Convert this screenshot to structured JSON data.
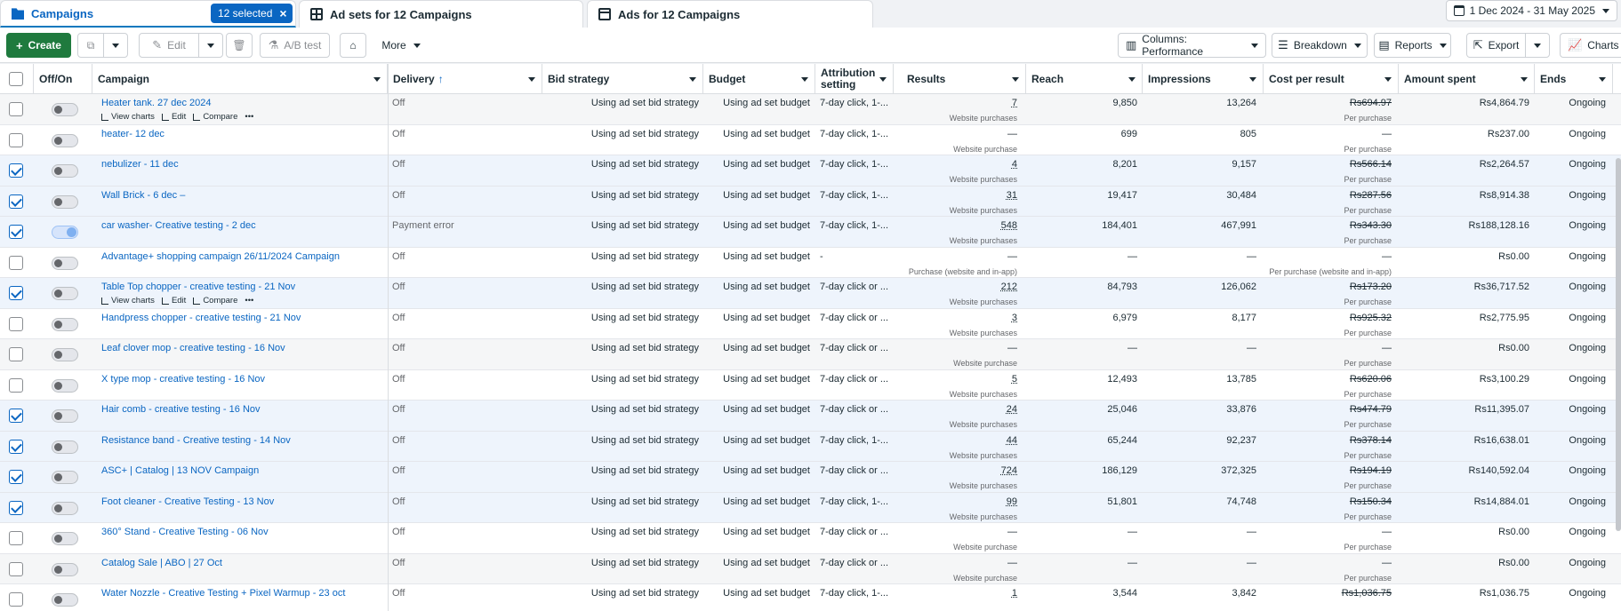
{
  "tabs": {
    "campaigns": "Campaigns",
    "selected": "12 selected",
    "adsets": "Ad sets for 12 Campaigns",
    "ads": "Ads for 12 Campaigns"
  },
  "date_range": "1 Dec 2024 - 31 May 2025",
  "toolbar": {
    "create": "Create",
    "edit": "Edit",
    "ab_test": "A/B test",
    "more": "More",
    "columns": "Columns: Performance",
    "breakdown": "Breakdown",
    "reports": "Reports",
    "export": "Export",
    "charts": "Charts"
  },
  "columns": {
    "onoff": "Off/On",
    "campaign": "Campaign",
    "delivery": "Delivery",
    "bid_strategy": "Bid strategy",
    "budget": "Budget",
    "attribution": "Attribution setting",
    "results": "Results",
    "reach": "Reach",
    "impressions": "Impressions",
    "cpr": "Cost per result",
    "amount": "Amount spent",
    "ends": "Ends"
  },
  "row_actions": {
    "view_charts": "View charts",
    "edit": "Edit",
    "compare": "Compare",
    "more": "•••"
  },
  "rows": [
    {
      "name": "Heater tank. 27 dec 2024",
      "delivery": "Off",
      "bid": "Using ad set bid strategy",
      "budget": "Using ad set budget",
      "attr": "7-day click, 1-...",
      "results": "7",
      "results_sub": "Website purchases",
      "reach": "9,850",
      "imp": "13,264",
      "cpr": "Rs694.97",
      "cpr_sub": "Per purchase",
      "amount": "Rs4,864.79",
      "ends": "Ongoing"
    },
    {
      "name": "heater- 12 dec",
      "delivery": "Off",
      "bid": "Using ad set bid strategy",
      "budget": "Using ad set budget",
      "attr": "7-day click, 1-...",
      "results": "—",
      "results_sub": "Website purchase",
      "reach": "699",
      "imp": "805",
      "cpr": "—",
      "cpr_sub": "Per purchase",
      "amount": "Rs237.00",
      "ends": "Ongoing"
    },
    {
      "name": "nebulizer - 11 dec",
      "delivery": "Off",
      "bid": "Using ad set bid strategy",
      "budget": "Using ad set budget",
      "attr": "7-day click, 1-...",
      "results": "4",
      "results_sub": "Website purchases",
      "reach": "8,201",
      "imp": "9,157",
      "cpr": "Rs566.14",
      "cpr_sub": "Per purchase",
      "amount": "Rs2,264.57",
      "ends": "Ongoing"
    },
    {
      "name": "Wall Brick - 6 dec –",
      "delivery": "Off",
      "bid": "Using ad set bid strategy",
      "budget": "Using ad set budget",
      "attr": "7-day click, 1-...",
      "results": "31",
      "results_sub": "Website purchases",
      "reach": "19,417",
      "imp": "30,484",
      "cpr": "Rs287.56",
      "cpr_sub": "Per purchase",
      "amount": "Rs8,914.38",
      "ends": "Ongoing"
    },
    {
      "name": "car washer- Creative testing - 2 dec",
      "delivery": "Payment error",
      "bid": "Using ad set bid strategy",
      "budget": "Using ad set budget",
      "attr": "7-day click, 1-...",
      "results": "548",
      "results_sub": "Website purchases",
      "reach": "184,401",
      "imp": "467,991",
      "cpr": "Rs343.30",
      "cpr_sub": "Per purchase",
      "amount": "Rs188,128.16",
      "ends": "Ongoing"
    },
    {
      "name": "Advantage+ shopping campaign 26/11/2024 Campaign",
      "delivery": "Off",
      "bid": "Using ad set bid strategy",
      "budget": "Using ad set budget",
      "attr": "-",
      "results": "—",
      "results_sub": "Purchase (website and in-app)",
      "reach": "—",
      "imp": "—",
      "cpr": "—",
      "cpr_sub": "Per purchase (website and in-app)",
      "amount": "Rs0.00",
      "ends": "Ongoing"
    },
    {
      "name": "Table Top chopper - creative testing - 21 Nov",
      "delivery": "Off",
      "bid": "Using ad set bid strategy",
      "budget": "Using ad set budget",
      "attr": "7-day click or ...",
      "results": "212",
      "results_sub": "Website purchases",
      "reach": "84,793",
      "imp": "126,062",
      "cpr": "Rs173.20",
      "cpr_sub": "Per purchase",
      "amount": "Rs36,717.52",
      "ends": "Ongoing"
    },
    {
      "name": "Handpress chopper - creative testing - 21 Nov",
      "delivery": "Off",
      "bid": "Using ad set bid strategy",
      "budget": "Using ad set budget",
      "attr": "7-day click or ...",
      "results": "3",
      "results_sub": "Website purchases",
      "reach": "6,979",
      "imp": "8,177",
      "cpr": "Rs925.32",
      "cpr_sub": "Per purchase",
      "amount": "Rs2,775.95",
      "ends": "Ongoing"
    },
    {
      "name": "Leaf clover mop - creative testing - 16 Nov",
      "delivery": "Off",
      "bid": "Using ad set bid strategy",
      "budget": "Using ad set budget",
      "attr": "7-day click or ...",
      "results": "—",
      "results_sub": "Website purchase",
      "reach": "—",
      "imp": "—",
      "cpr": "—",
      "cpr_sub": "Per purchase",
      "amount": "Rs0.00",
      "ends": "Ongoing"
    },
    {
      "name": "X type mop - creative testing - 16 Nov",
      "delivery": "Off",
      "bid": "Using ad set bid strategy",
      "budget": "Using ad set budget",
      "attr": "7-day click or ...",
      "results": "5",
      "results_sub": "Website purchases",
      "reach": "12,493",
      "imp": "13,785",
      "cpr": "Rs620.06",
      "cpr_sub": "Per purchase",
      "amount": "Rs3,100.29",
      "ends": "Ongoing"
    },
    {
      "name": "Hair comb - creative testing - 16 Nov",
      "delivery": "Off",
      "bid": "Using ad set bid strategy",
      "budget": "Using ad set budget",
      "attr": "7-day click or ...",
      "results": "24",
      "results_sub": "Website purchases",
      "reach": "25,046",
      "imp": "33,876",
      "cpr": "Rs474.79",
      "cpr_sub": "Per purchase",
      "amount": "Rs11,395.07",
      "ends": "Ongoing"
    },
    {
      "name": "Resistance band - Creative testing - 14 Nov",
      "delivery": "Off",
      "bid": "Using ad set bid strategy",
      "budget": "Using ad set budget",
      "attr": "7-day click, 1-...",
      "results": "44",
      "results_sub": "Website purchases",
      "reach": "65,244",
      "imp": "92,237",
      "cpr": "Rs378.14",
      "cpr_sub": "Per purchase",
      "amount": "Rs16,638.01",
      "ends": "Ongoing"
    },
    {
      "name": "ASC+ | Catalog | 13 NOV Campaign",
      "delivery": "Off",
      "bid": "Using ad set bid strategy",
      "budget": "Using ad set budget",
      "attr": "7-day click or ...",
      "results": "724",
      "results_sub": "Website purchases",
      "reach": "186,129",
      "imp": "372,325",
      "cpr": "Rs194.19",
      "cpr_sub": "Per purchase",
      "amount": "Rs140,592.04",
      "ends": "Ongoing"
    },
    {
      "name": "Foot cleaner - Creative Testing - 13 Nov",
      "delivery": "Off",
      "bid": "Using ad set bid strategy",
      "budget": "Using ad set budget",
      "attr": "7-day click, 1-...",
      "results": "99",
      "results_sub": "Website purchases",
      "reach": "51,801",
      "imp": "74,748",
      "cpr": "Rs150.34",
      "cpr_sub": "Per purchase",
      "amount": "Rs14,884.01",
      "ends": "Ongoing"
    },
    {
      "name": "360° Stand - Creative Testing - 06 Nov",
      "delivery": "Off",
      "bid": "Using ad set bid strategy",
      "budget": "Using ad set budget",
      "attr": "7-day click or ...",
      "results": "—",
      "results_sub": "Website purchase",
      "reach": "—",
      "imp": "—",
      "cpr": "—",
      "cpr_sub": "Per purchase",
      "amount": "Rs0.00",
      "ends": "Ongoing"
    },
    {
      "name": "Catalog Sale | ABO | 27 Oct",
      "delivery": "Off",
      "bid": "Using ad set bid strategy",
      "budget": "Using ad set budget",
      "attr": "7-day click or ...",
      "results": "—",
      "results_sub": "Website purchase",
      "reach": "—",
      "imp": "—",
      "cpr": "—",
      "cpr_sub": "Per purchase",
      "amount": "Rs0.00",
      "ends": "Ongoing"
    },
    {
      "name": "Water Nozzle - Creative Testing + Pixel Warmup - 23 oct",
      "delivery": "Off",
      "bid": "Using ad set bid strategy",
      "budget": "Using ad set budget",
      "attr": "7-day click, 1-...",
      "results": "1",
      "results_sub": "",
      "reach": "3,544",
      "imp": "3,842",
      "cpr": "Rs1,036.75",
      "cpr_sub": "",
      "amount": "Rs1,036.75",
      "ends": "Ongoing"
    }
  ]
}
